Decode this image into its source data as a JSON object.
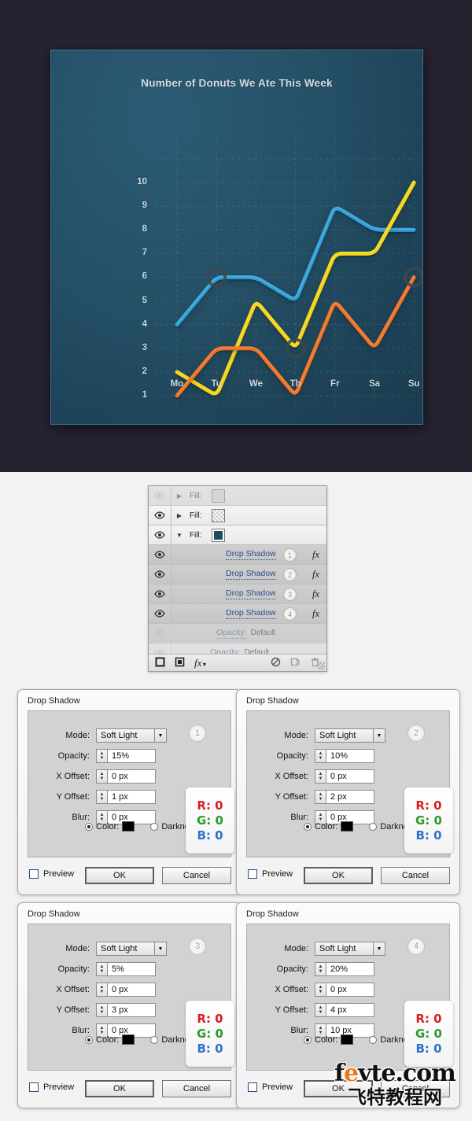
{
  "chart_data": {
    "type": "line",
    "title": "Number of Donuts We Ate This Week",
    "xlabel": "",
    "ylabel": "",
    "ylim": [
      0,
      10
    ],
    "yticks": [
      "10",
      "9",
      "8",
      "7",
      "6",
      "5",
      "4",
      "3",
      "2",
      "1"
    ],
    "categories": [
      "Mo",
      "Tu",
      "We",
      "Th",
      "Fr",
      "Sa",
      "Su"
    ],
    "grid": true,
    "legend": "none",
    "series": [
      {
        "name": "blue",
        "color": "#2f9fd8",
        "values": [
          4,
          6,
          6,
          5,
          9,
          8,
          8
        ]
      },
      {
        "name": "yellow",
        "color": "#f5d415",
        "values": [
          2,
          1,
          5,
          3,
          7,
          7,
          10
        ]
      },
      {
        "name": "orange",
        "color": "#ee7024",
        "values": [
          1,
          3,
          3,
          1,
          5,
          3,
          6
        ]
      }
    ],
    "markers": [
      {
        "series": "blue",
        "category": "Tu"
      },
      {
        "series": "yellow",
        "category": "Th"
      },
      {
        "series": "orange",
        "category": "Su"
      }
    ],
    "colors": {
      "canvas_background": "#262231",
      "plot_background": "#245066",
      "plot_border": "#3d6d86",
      "tick_text": "#cdd8de",
      "title_text": "#d4dde3",
      "gridline": "#6d8fa0",
      "marker_ring": "#3b4750"
    }
  },
  "layers_panel": {
    "rows": [
      {
        "kind": "layer",
        "eye": true,
        "disclosure": "▶",
        "label": "Fill:",
        "thumb": "solid-grey",
        "dim": true,
        "selected": false
      },
      {
        "kind": "layer",
        "eye": true,
        "disclosure": "▶",
        "label": "Fill:",
        "thumb": "checker",
        "dim": false,
        "selected": false
      },
      {
        "kind": "layer",
        "eye": true,
        "disclosure": "▼",
        "label": "Fill:",
        "thumb": "navy",
        "dim": false,
        "selected": false
      },
      {
        "kind": "effect",
        "eye": true,
        "label": "Drop Shadow",
        "badge": "1",
        "fx": "fx",
        "selected": true
      },
      {
        "kind": "effect",
        "eye": true,
        "label": "Drop Shadow",
        "badge": "2",
        "fx": "fx",
        "selected": true
      },
      {
        "kind": "effect",
        "eye": true,
        "label": "Drop Shadow",
        "badge": "3",
        "fx": "fx",
        "selected": true
      },
      {
        "kind": "effect",
        "eye": true,
        "label": "Drop Shadow",
        "badge": "4",
        "fx": "fx",
        "selected": true
      },
      {
        "kind": "prop",
        "eye": true,
        "label": "Opacity:",
        "value": "Default",
        "dim": true,
        "selected": true
      },
      {
        "kind": "prop",
        "eye": true,
        "label": "Opacity:",
        "value": "Default",
        "dim": true,
        "selected": false
      }
    ],
    "toolbar": {
      "new_layer_icon": "square-outline-icon",
      "mask_icon": "add-mask-icon",
      "fx_icon": "fx-menu-icon",
      "disable_icon": "no-entry-icon",
      "duplicate_icon": "duplicate-layer-icon",
      "delete_icon": "trash-icon"
    }
  },
  "dialogs": [
    {
      "title": "Drop Shadow",
      "badge": "1",
      "mode_label": "Mode:",
      "mode_value": "Soft Light",
      "opacity_label": "Opacity:",
      "opacity_value": "15%",
      "xoffset_label": "X Offset:",
      "xoffset_value": "0 px",
      "yoffset_label": "Y Offset:",
      "yoffset_value": "1 px",
      "blur_label": "Blur:",
      "blur_value": "0 px",
      "color_label": "Color:",
      "darkness_label": "Darkness",
      "preview_label": "Preview",
      "ok_label": "OK",
      "cancel_label": "Cancel",
      "rgb": {
        "r": "R: 0",
        "g": "G: 0",
        "b": "B: 0"
      }
    },
    {
      "title": "Drop Shadow",
      "badge": "2",
      "mode_label": "Mode:",
      "mode_value": "Soft Light",
      "opacity_label": "Opacity:",
      "opacity_value": "10%",
      "xoffset_label": "X Offset:",
      "xoffset_value": "0 px",
      "yoffset_label": "Y Offset:",
      "yoffset_value": "2 px",
      "blur_label": "Blur:",
      "blur_value": "0 px",
      "color_label": "Color:",
      "darkness_label": "Darkness",
      "preview_label": "Preview",
      "ok_label": "OK",
      "cancel_label": "Cancel",
      "rgb": {
        "r": "R: 0",
        "g": "G: 0",
        "b": "B: 0"
      }
    },
    {
      "title": "Drop Shadow",
      "badge": "3",
      "mode_label": "Mode:",
      "mode_value": "Soft Light",
      "opacity_label": "Opacity:",
      "opacity_value": "5%",
      "xoffset_label": "X Offset:",
      "xoffset_value": "0 px",
      "yoffset_label": "Y Offset:",
      "yoffset_value": "3 px",
      "blur_label": "Blur:",
      "blur_value": "0 px",
      "color_label": "Color:",
      "darkness_label": "Darkness",
      "preview_label": "Preview",
      "ok_label": "OK",
      "cancel_label": "Cancel",
      "rgb": {
        "r": "R: 0",
        "g": "G: 0",
        "b": "B: 0"
      }
    },
    {
      "title": "Drop Shadow",
      "badge": "4",
      "mode_label": "Mode:",
      "mode_value": "Soft Light",
      "opacity_label": "Opacity:",
      "opacity_value": "20%",
      "xoffset_label": "X Offset:",
      "xoffset_value": "0 px",
      "yoffset_label": "Y Offset:",
      "yoffset_value": "4 px",
      "blur_label": "Blur:",
      "blur_value": "10 px",
      "color_label": "Color:",
      "darkness_label": "Darkness",
      "preview_label": "Preview",
      "ok_label": "OK",
      "cancel_label": "Cancel",
      "rgb": {
        "r": "R: 0",
        "g": "G: 0",
        "b": "B: 0"
      }
    }
  ],
  "watermark": {
    "english": "fevte.com",
    "chinese": "飞特教程网"
  }
}
